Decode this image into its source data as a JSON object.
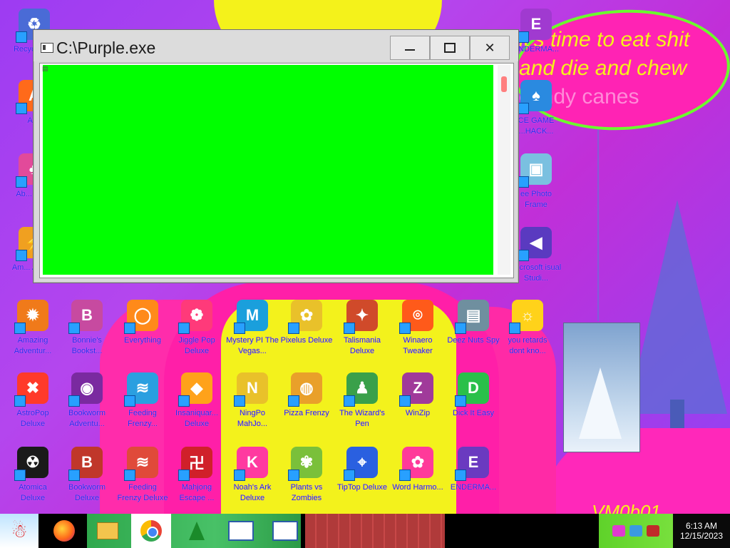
{
  "window": {
    "title": "C:\\Purple.exe",
    "minimize_glyph": "",
    "maximize_glyph": "",
    "close_glyph": "✕",
    "client_color": "#00ff00"
  },
  "wallpaper": {
    "bubble_lines": [
      "it's time to eat shit",
      "and die and chew",
      "candy canes"
    ],
    "signature": "VM0b01"
  },
  "desktop_icons": [
    {
      "label": "Recycle Bin",
      "color": "#4a6bd6",
      "glyph": "♻"
    },
    {
      "label": "Al...",
      "color": "#ff6a1a",
      "glyph": "A"
    },
    {
      "label": "Ab... Del...",
      "color": "#e24a9a",
      "glyph": "♣"
    },
    {
      "label": "Am... Adve...",
      "color": "#f0a020",
      "glyph": "⚡"
    },
    {
      "label": "Amazing Adventur...",
      "color": "#f07a1a",
      "glyph": "✹"
    },
    {
      "label": "Bonnie's Bookst...",
      "color": "#c74aa0",
      "glyph": "B"
    },
    {
      "label": "Everything",
      "color": "#ff8a1a",
      "glyph": "◯"
    },
    {
      "label": "Jiggle Pop Deluxe",
      "color": "#ff3a7a",
      "glyph": "❁"
    },
    {
      "label": "Mystery PI The Vegas...",
      "color": "#1a9fdc",
      "glyph": "M"
    },
    {
      "label": "Pixelus Deluxe",
      "color": "#e9c12a",
      "glyph": "✿"
    },
    {
      "label": "Talismania Deluxe",
      "color": "#d04a2a",
      "glyph": "✦"
    },
    {
      "label": "Winaero Tweaker",
      "color": "#ff5a1a",
      "glyph": "⌾"
    },
    {
      "label": "Deez Nuts Spy",
      "color": "#6f8f9f",
      "glyph": "▤"
    },
    {
      "label": "you retards dont kno...",
      "color": "#ffd21a",
      "glyph": "☼"
    },
    {
      "label": "AstroPop Deluxe",
      "color": "#ff3a2a",
      "glyph": "✖"
    },
    {
      "label": "Bookworm Adventu...",
      "color": "#7a2aa0",
      "glyph": "◉"
    },
    {
      "label": "Feeding Frenzy...",
      "color": "#2a9fe0",
      "glyph": "≋"
    },
    {
      "label": "Insaniquar... Deluxe",
      "color": "#ffa21a",
      "glyph": "◆"
    },
    {
      "label": "NingPo MahJo...",
      "color": "#e9c12a",
      "glyph": "N"
    },
    {
      "label": "Pizza Frenzy",
      "color": "#e9a02a",
      "glyph": "◍"
    },
    {
      "label": "The Wizard's Pen",
      "color": "#3aa04a",
      "glyph": "♟"
    },
    {
      "label": "WinZip",
      "color": "#a03a9a",
      "glyph": "Z"
    },
    {
      "label": "Dick It Easy",
      "color": "#2ac04a",
      "glyph": "D"
    },
    {
      "label": "Atomica Deluxe",
      "color": "#1a1a1a",
      "glyph": "☢"
    },
    {
      "label": "Bookworm Deluxe",
      "color": "#c0372a",
      "glyph": "B"
    },
    {
      "label": "Feeding Frenzy Deluxe",
      "color": "#e04a3a",
      "glyph": "≋"
    },
    {
      "label": "Mahjong Escape ...",
      "color": "#d0202a",
      "glyph": "卍"
    },
    {
      "label": "Noah's Ark Deluxe",
      "color": "#ff3aa0",
      "glyph": "K"
    },
    {
      "label": "Plants vs Zombies",
      "color": "#7ac03a",
      "glyph": "✾"
    },
    {
      "label": "TipTop Deluxe",
      "color": "#2a60e0",
      "glyph": "⌖"
    },
    {
      "label": "Word Harmo...",
      "color": "#ff3a9a",
      "glyph": "✿"
    },
    {
      "label": "ENDERMA...",
      "color": "#6a3ac0",
      "glyph": "E"
    },
    {
      "label": "ENDERMA...",
      "color": "#a03ad0",
      "glyph": "E"
    },
    {
      "label": "CE GAME ...HACK...",
      "color": "#2a8ae0",
      "glyph": "♠"
    },
    {
      "label": "ee Photo Frame",
      "color": "#7ac0e0",
      "glyph": "▣"
    },
    {
      "label": "Microsoft isual Studi...",
      "color": "#5a3ac0",
      "glyph": "◀"
    }
  ],
  "taskbar": {
    "start_icon": "santa-icon",
    "time": "6:13 AM",
    "date": "12/15/2023",
    "notification_count": "3"
  }
}
